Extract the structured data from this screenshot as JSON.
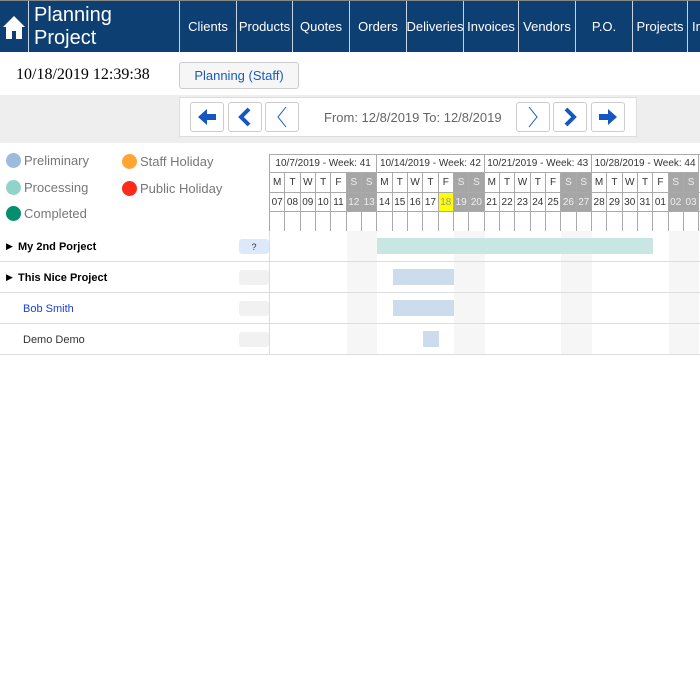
{
  "nav": {
    "title": "Planning Project",
    "items": [
      "Clients",
      "Products",
      "Quotes",
      "Orders",
      "Deliveries",
      "Invoices",
      "Vendors",
      "P.O.",
      "Projects",
      "In"
    ]
  },
  "clock": "10/18/2019 12:39:38",
  "view_button": "Planning (Staff)",
  "range_text": "From: 12/8/2019 To: 12/8/2019",
  "legend": [
    {
      "label": "Preliminary",
      "color": "#9dbbdc"
    },
    {
      "label": "Staff Holiday",
      "color": "#ffa533"
    },
    {
      "label": "Processing",
      "color": "#92d3c9"
    },
    {
      "label": "Public Holiday",
      "color": "#ff2a1a"
    },
    {
      "label": "Completed",
      "color": "#04906e"
    }
  ],
  "weeks": [
    "10/7/2019 - Week: 41",
    "10/14/2019 - Week: 42",
    "10/21/2019 - Week: 43",
    "10/28/2019 - Week: 44"
  ],
  "day_letters": [
    "M",
    "T",
    "W",
    "T",
    "F",
    "S",
    "S"
  ],
  "dates": [
    "07",
    "08",
    "09",
    "10",
    "11",
    "12",
    "13",
    "14",
    "15",
    "16",
    "17",
    "18",
    "19",
    "20",
    "21",
    "22",
    "23",
    "24",
    "25",
    "26",
    "27",
    "28",
    "29",
    "30",
    "31",
    "01",
    "02",
    "03"
  ],
  "today": "18",
  "rows": [
    {
      "label": "My 2nd Porject",
      "expandable": true,
      "tag": "?",
      "bar": {
        "start": "14",
        "end": "31",
        "color": "#c8e6e2"
      }
    },
    {
      "label": "This Nice Project",
      "expandable": true,
      "tag": "",
      "bar": {
        "start": "15",
        "end": "18",
        "color": "#cddcec"
      }
    },
    {
      "label": "Bob Smith",
      "expandable": false,
      "tag": "",
      "link": true,
      "bar": {
        "start": "15",
        "end": "18",
        "color": "#cddcec"
      }
    },
    {
      "label": "Demo Demo",
      "expandable": false,
      "tag": "",
      "bar": {
        "start": "17",
        "end": "17",
        "color": "#cddcec"
      }
    }
  ]
}
